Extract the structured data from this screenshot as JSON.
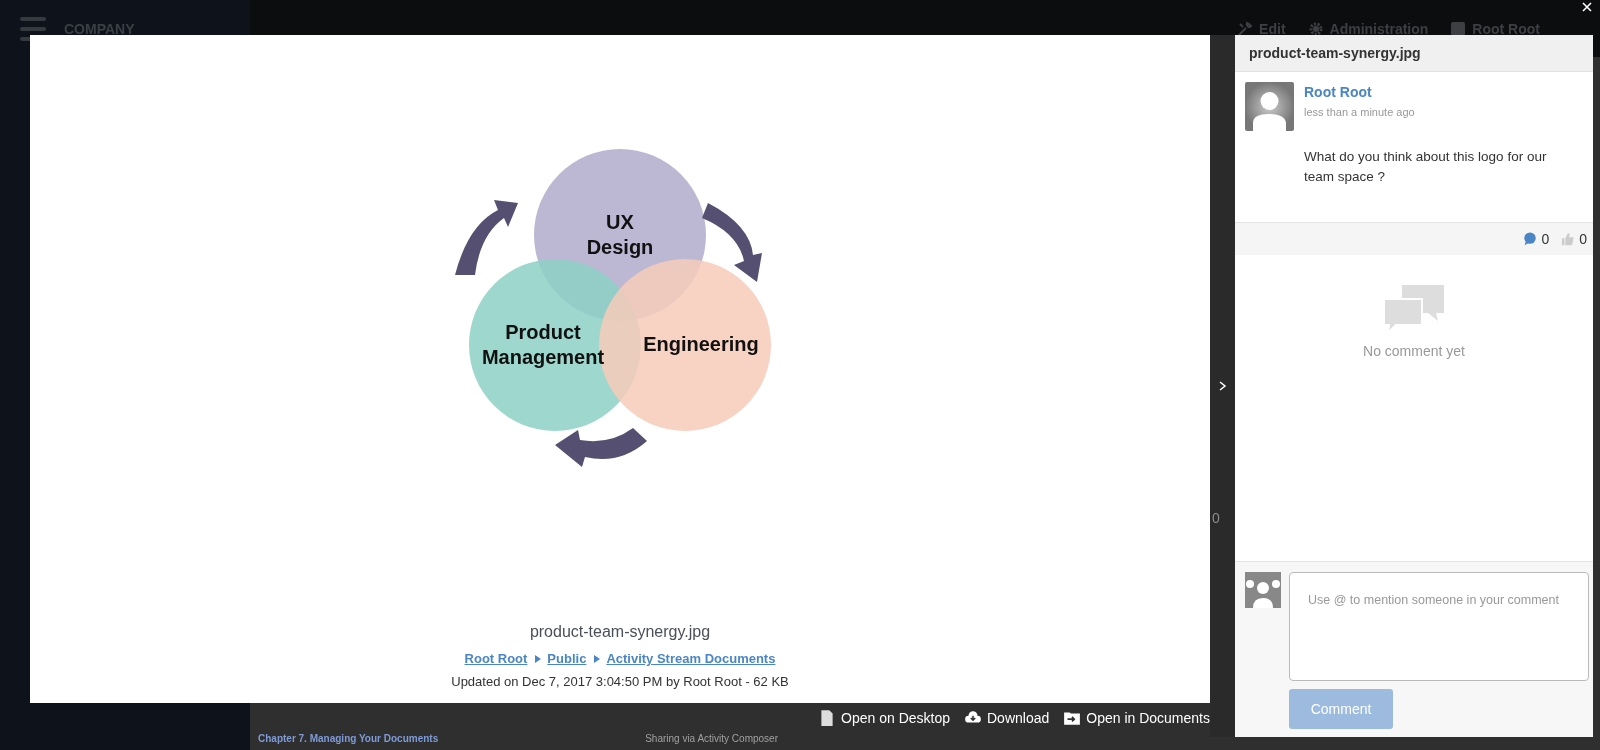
{
  "background": {
    "sidebar_title": "COMPANY",
    "topbar": [
      {
        "label": "Edit",
        "kind": "tools"
      },
      {
        "label": "Administration",
        "kind": "gear"
      }
    ],
    "user": "Root Root",
    "document": {
      "heading": "Chapter 7. Managing Your Documents",
      "section": "Sharing via Activity Composer"
    },
    "count": "0"
  },
  "viewer": {
    "diagram": {
      "circles": [
        {
          "lines": [
            "UX",
            "Design"
          ],
          "color": "#bcb8d4"
        },
        {
          "lines": [
            "Product",
            "Management"
          ],
          "color": "#8dd0c4"
        },
        {
          "lines": [
            "Engineering"
          ],
          "color": "#f7cbb9"
        }
      ]
    },
    "file_name": "product-team-synergy.jpg",
    "breadcrumb": [
      "Root Root",
      "Public",
      "Activity Stream Documents"
    ],
    "info": "Updated on Dec 7, 2017 3:04:50 PM by Root Root - 62 KB",
    "actions": [
      {
        "label": "Open on Desktop",
        "kind": "desktop"
      },
      {
        "label": "Download",
        "kind": "download"
      },
      {
        "label": "Open in Documents",
        "kind": "documents"
      }
    ]
  },
  "panel": {
    "title": "product-team-synergy.jpg",
    "post": {
      "author": "Root Root",
      "time": "less than a minute ago",
      "message": "What do you think about this logo for our team space ?"
    },
    "comments_count": "0",
    "likes_count": "0",
    "empty_text": "No comment yet",
    "comment_field": {
      "placeholder": "Use @ to mention someone in your comment"
    },
    "submit": {
      "label": "Comment",
      "disabled": true
    }
  }
}
